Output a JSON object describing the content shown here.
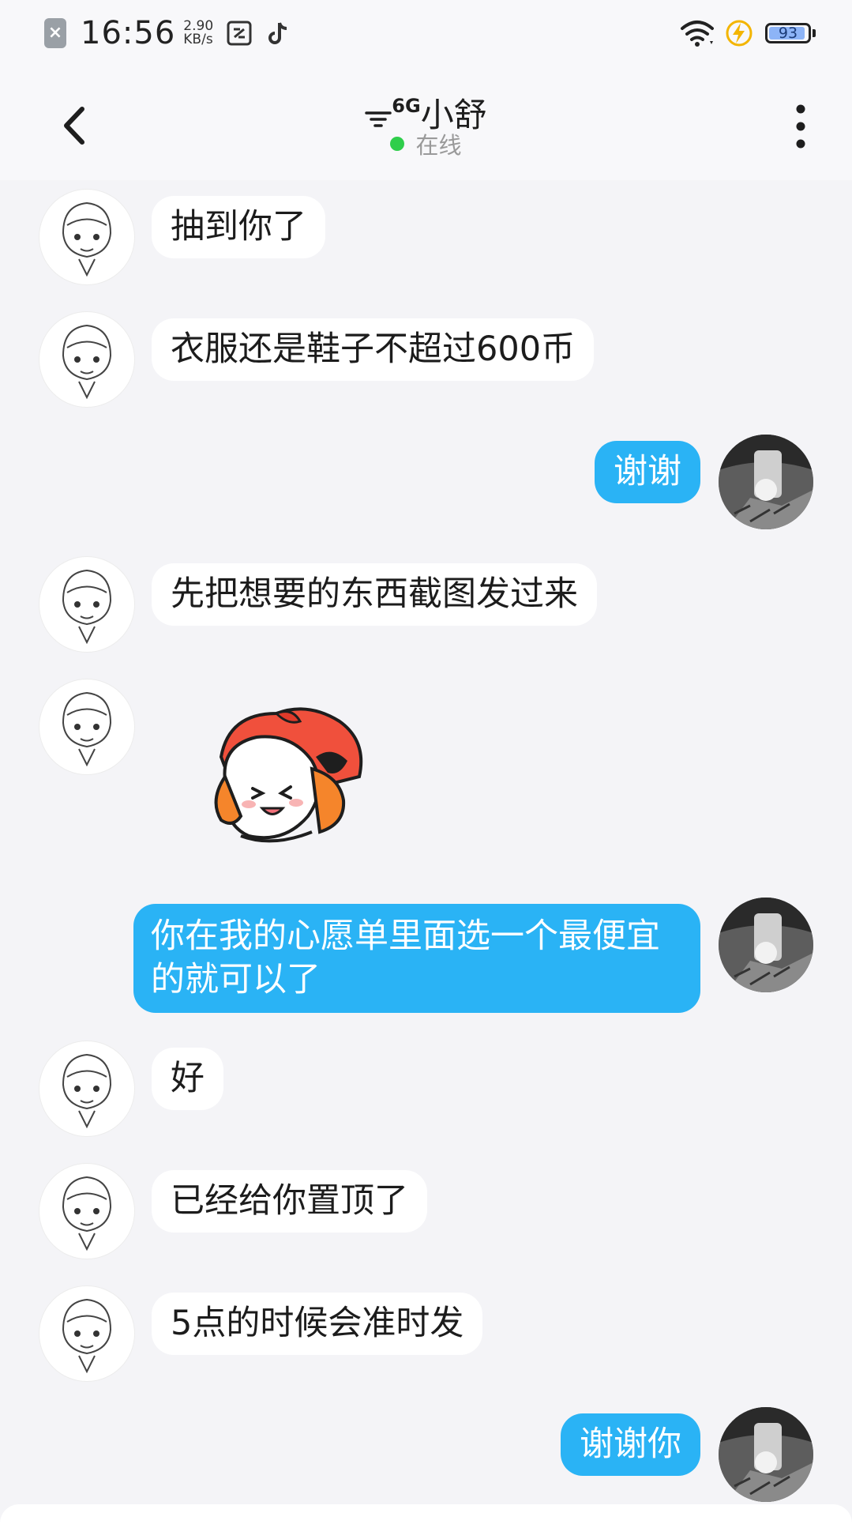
{
  "status_bar": {
    "time": "16:56",
    "net_speed_value": "2.90",
    "net_speed_unit": "KB/s",
    "battery": "93",
    "icons": [
      "sim-card-icon",
      "screenshot-app-icon",
      "tiktok-icon",
      "wifi-icon",
      "charging-icon",
      "battery-icon"
    ]
  },
  "header": {
    "title": "小舒",
    "title_prefix": "6G",
    "status": "在线",
    "online_color": "#2fce4b"
  },
  "colors": {
    "outgoing_bubble": "#2ab3f5",
    "incoming_bubble": "#ffffff",
    "background": "#f4f4f7"
  },
  "messages": [
    {
      "from": "other",
      "type": "text",
      "text": "抽到你了"
    },
    {
      "from": "other",
      "type": "text",
      "text": "衣服还是鞋子不超过600币"
    },
    {
      "from": "me",
      "type": "text",
      "text": "谢谢"
    },
    {
      "from": "other",
      "type": "text",
      "text": "先把想要的东西截图发过来"
    },
    {
      "from": "other",
      "type": "sticker",
      "sticker": "anime-girl-sticker"
    },
    {
      "from": "me",
      "type": "text",
      "text": "你在我的心愿单里面选一个最便宜的就可以了"
    },
    {
      "from": "other",
      "type": "text",
      "text": "好"
    },
    {
      "from": "other",
      "type": "text",
      "text": "已经给你置顶了"
    },
    {
      "from": "other",
      "type": "text",
      "text": "5点的时候会准时发"
    },
    {
      "from": "me",
      "type": "text",
      "text": "谢谢你"
    }
  ]
}
